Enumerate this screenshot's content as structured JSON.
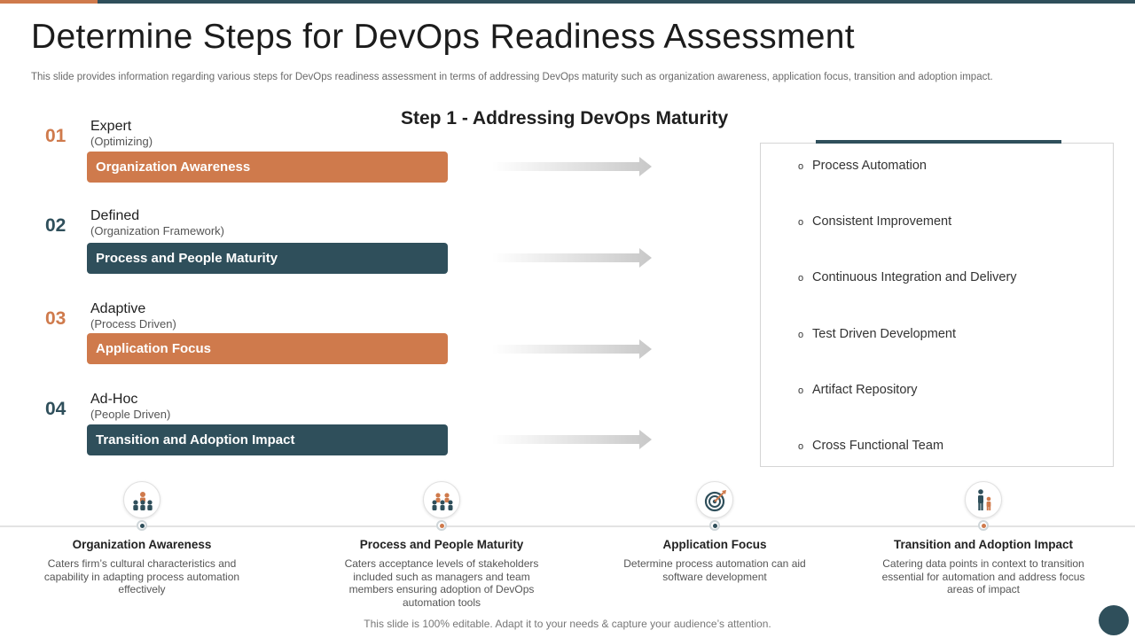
{
  "title": "Determine Steps for DevOps Readiness Assessment",
  "subtitle": "This slide provides information regarding various steps for DevOps readiness assessment in terms of addressing DevOps maturity such as organization awareness, application focus, transition and adoption impact.",
  "step_heading": "Step 1 - Addressing DevOps Maturity",
  "levels": [
    {
      "num": "01",
      "name": "Expert",
      "sub": "(Optimizing)",
      "bar": "Organization Awareness"
    },
    {
      "num": "02",
      "name": "Defined",
      "sub": "(Organization Framework)",
      "bar": "Process and  People Maturity"
    },
    {
      "num": "03",
      "name": "Adaptive",
      "sub": "(Process Driven)",
      "bar": "Application Focus"
    },
    {
      "num": "04",
      "name": "Ad-Hoc",
      "sub": "(People Driven)",
      "bar": "Transition and Adoption Impact"
    }
  ],
  "panel": {
    "bullet": "o",
    "items": [
      "Process Automation",
      "Consistent Improvement",
      "Continuous Integration and Delivery",
      "Test Driven Development",
      "Artifact Repository",
      "Cross Functional Team"
    ]
  },
  "timeline": [
    {
      "title": "Organization Awareness",
      "desc": "Caters firm’s cultural characteristics and capability in adapting process automation effectively",
      "icon": "team-icon"
    },
    {
      "title": "Process and People Maturity",
      "desc": "Caters acceptance levels of stakeholders included such as managers and team members ensuring adoption of DevOps automation tools",
      "icon": "people-group-icon"
    },
    {
      "title": "Application Focus",
      "desc": "Determine process automation can aid software development",
      "icon": "target-icon"
    },
    {
      "title": "Transition and Adoption Impact",
      "desc": "Catering data points in context to transition essential for automation and address focus areas of impact",
      "icon": "adult-child-icon"
    }
  ],
  "footer": "This slide is 100% editable. Adapt it to your needs & capture your audience’s attention.",
  "colors": {
    "accent": "#cf7a4c",
    "primary": "#2f4f5b"
  }
}
